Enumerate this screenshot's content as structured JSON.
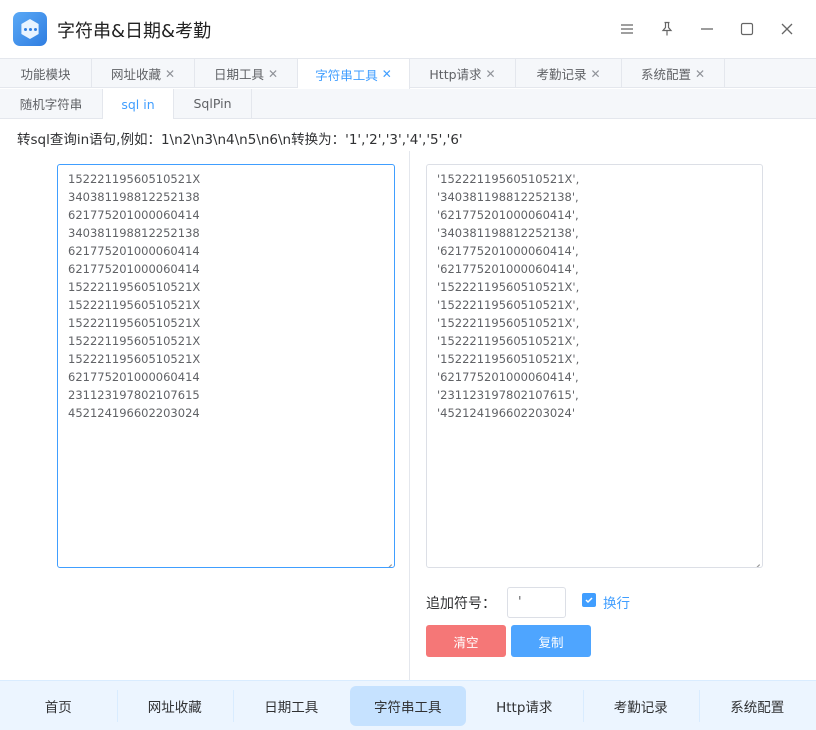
{
  "window": {
    "title": "字符串&日期&考勤",
    "controls": [
      "menu-icon",
      "pin-icon",
      "minimize-icon",
      "maximize-icon",
      "close-icon"
    ]
  },
  "top_tabs": [
    {
      "label": "功能模块",
      "closable": false
    },
    {
      "label": "网址收藏",
      "closable": true
    },
    {
      "label": "日期工具",
      "closable": true
    },
    {
      "label": "字符串工具",
      "closable": true,
      "active": true
    },
    {
      "label": "Http请求",
      "closable": true
    },
    {
      "label": "考勤记录",
      "closable": true
    },
    {
      "label": "系统配置",
      "closable": true
    }
  ],
  "sub_tabs": [
    {
      "label": "随机字符串"
    },
    {
      "label": "sql in",
      "active": true
    },
    {
      "label": "SqlPin"
    }
  ],
  "description": "转sql查询in语句,例如：1\\n2\\n3\\n4\\n5\\n6\\n转换为：'1','2','3','4','5','6'",
  "input_text": [
    "15222119560510521X",
    "340381198812252138",
    "621775201000060414",
    "340381198812252138",
    "621775201000060414",
    "621775201000060414",
    "15222119560510521X",
    "15222119560510521X",
    "15222119560510521X",
    "15222119560510521X",
    "15222119560510521X",
    "621775201000060414",
    "231123197802107615",
    "452124196602203024"
  ],
  "output_text": [
    "'15222119560510521X',",
    "'340381198812252138',",
    "'621775201000060414',",
    "'340381198812252138',",
    "'621775201000060414',",
    "'621775201000060414',",
    "'15222119560510521X',",
    "'15222119560510521X',",
    "'15222119560510521X',",
    "'15222119560510521X',",
    "'15222119560510521X',",
    "'621775201000060414',",
    "'231123197802107615',",
    "'452124196602203024'"
  ],
  "options": {
    "append_label": "追加符号：",
    "append_value": "'",
    "newline_label": "换行",
    "newline_checked": true
  },
  "buttons": {
    "clear": "清空",
    "copy": "复制"
  },
  "bottom_nav": [
    {
      "label": "首页"
    },
    {
      "label": "网址收藏"
    },
    {
      "label": "日期工具"
    },
    {
      "label": "字符串工具",
      "active": true
    },
    {
      "label": "Http请求"
    },
    {
      "label": "考勤记录"
    },
    {
      "label": "系统配置"
    }
  ],
  "colors": {
    "accent": "#409eff",
    "danger": "#f56c6c",
    "nav_bg": "#ecf5ff",
    "nav_active": "#c6e2ff"
  }
}
